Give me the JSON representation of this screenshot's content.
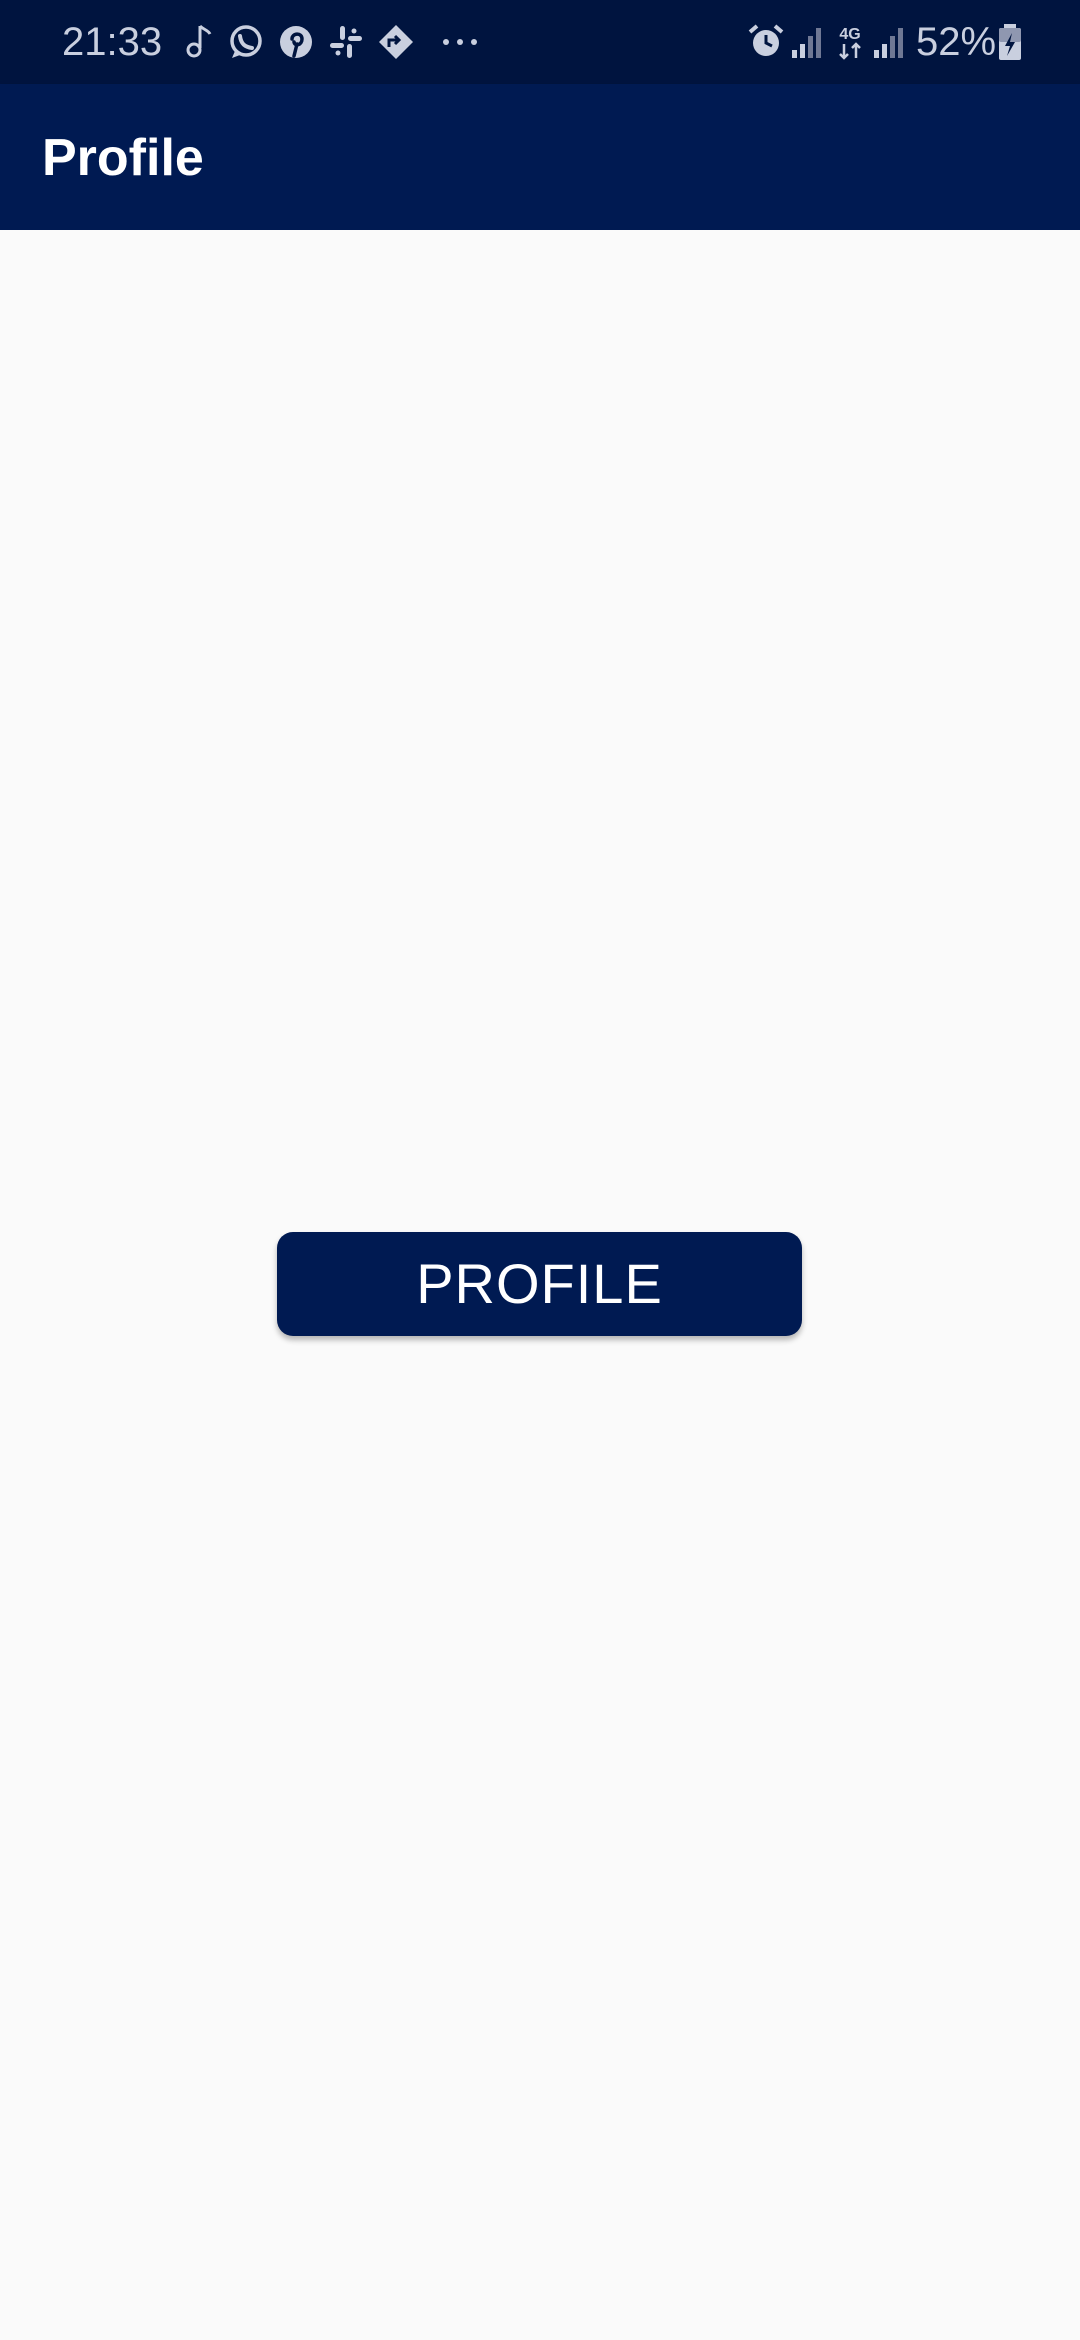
{
  "status_bar": {
    "time": "21:33",
    "battery_percent": "52%",
    "network_type": "4G",
    "notification_icons": [
      "music-note-icon",
      "whatsapp-icon",
      "pinterest-icon",
      "slack-icon",
      "navigation-icon",
      "more-icon"
    ],
    "system_icons": [
      "alarm-icon",
      "signal-icon",
      "signal-4g-icon",
      "signal-icon",
      "battery-charging-icon"
    ],
    "icon_color": "#c9cfdf",
    "background": "#00143f"
  },
  "app_bar": {
    "title": "Profile",
    "background": "#001a52"
  },
  "main": {
    "button_label": "PROFILE",
    "button_color": "#001a52",
    "background": "#fafafa"
  }
}
